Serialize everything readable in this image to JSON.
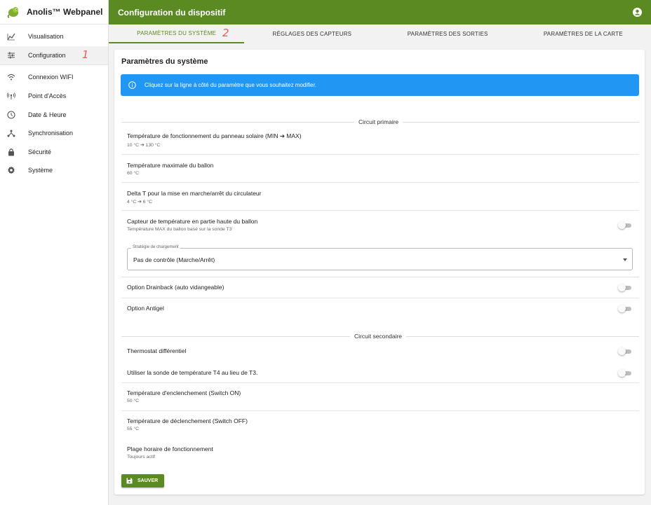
{
  "brand": {
    "name": "Anolis™ Webpanel",
    "logo_icon": "chameleon-logo-icon"
  },
  "sidebar": {
    "items": [
      {
        "label": "Visualisation",
        "icon": "chart-line-icon"
      },
      {
        "label": "Configuration",
        "icon": "sliders-icon",
        "active": true
      },
      {
        "label": "Connexion WIFI",
        "icon": "wifi-icon"
      },
      {
        "label": "Point d'Accès",
        "icon": "access-point-icon"
      },
      {
        "label": "Date & Heure",
        "icon": "clock-icon"
      },
      {
        "label": "Synchronisation",
        "icon": "sync-network-icon"
      },
      {
        "label": "Sécurité",
        "icon": "lock-icon"
      },
      {
        "label": "Système",
        "icon": "gear-icon"
      }
    ]
  },
  "markers": {
    "one": "1",
    "two": "2"
  },
  "topbar": {
    "title": "Configuration du dispositif",
    "account_icon": "account-circle-icon"
  },
  "tabs": [
    {
      "label": "Paramètres du système",
      "active": true
    },
    {
      "label": "Réglages des capteurs"
    },
    {
      "label": "Paramètres des sorties"
    },
    {
      "label": "Paramètres de la carte"
    }
  ],
  "card": {
    "title": "Paramètres du système",
    "info": "Cliquez sur la ligne à côté du paramètre que vous souhaitez modifier."
  },
  "sections": {
    "primary": "Circuit primaire",
    "secondary": "Circuit secondaire"
  },
  "settings": {
    "solar_temp": {
      "title": "Température de fonctionnement du panneau solaire (MIN ➔ MAX)",
      "value": "10 °C ➔ 130 °C"
    },
    "tank_max": {
      "title": "Température maximale du ballon",
      "value": "60 °C"
    },
    "delta_t": {
      "title": "Delta T pour la mise en marche/arrêt du circulateur",
      "value": "4 °C ➔ 6 °C"
    },
    "top_sensor": {
      "title": "Capteur de température en partie haute du ballon",
      "value": "Température MAX du ballon basé sur la sonde T3",
      "enabled": false
    },
    "strategy": {
      "legend": "Stratégie de chargement",
      "value": "Pas de contrôle (Marche/Arrêt)"
    },
    "drainback": {
      "title": "Option Drainback (auto vidangeable)",
      "enabled": false
    },
    "antigel": {
      "title": "Option Antigel",
      "enabled": false
    },
    "thermostat": {
      "title": "Thermostat différentiel",
      "enabled": false
    },
    "use_t4": {
      "title": "Utiliser la sonde de température T4 au lieu de T3.",
      "enabled": false
    },
    "switch_on": {
      "title": "Température d'enclenchement (Switch ON)",
      "value": "50 °C"
    },
    "switch_off": {
      "title": "Température de déclenchement (Switch OFF)",
      "value": "55 °C"
    },
    "schedule": {
      "title": "Plage horaire de fonctionnement",
      "value": "Toujours actif"
    }
  },
  "save_button": {
    "label": "SAUVER",
    "icon": "floppy-disk-icon"
  },
  "colors": {
    "primary_green": "#5b8a22",
    "info_blue": "#2196f3",
    "marker_red": "#e35d5d"
  }
}
